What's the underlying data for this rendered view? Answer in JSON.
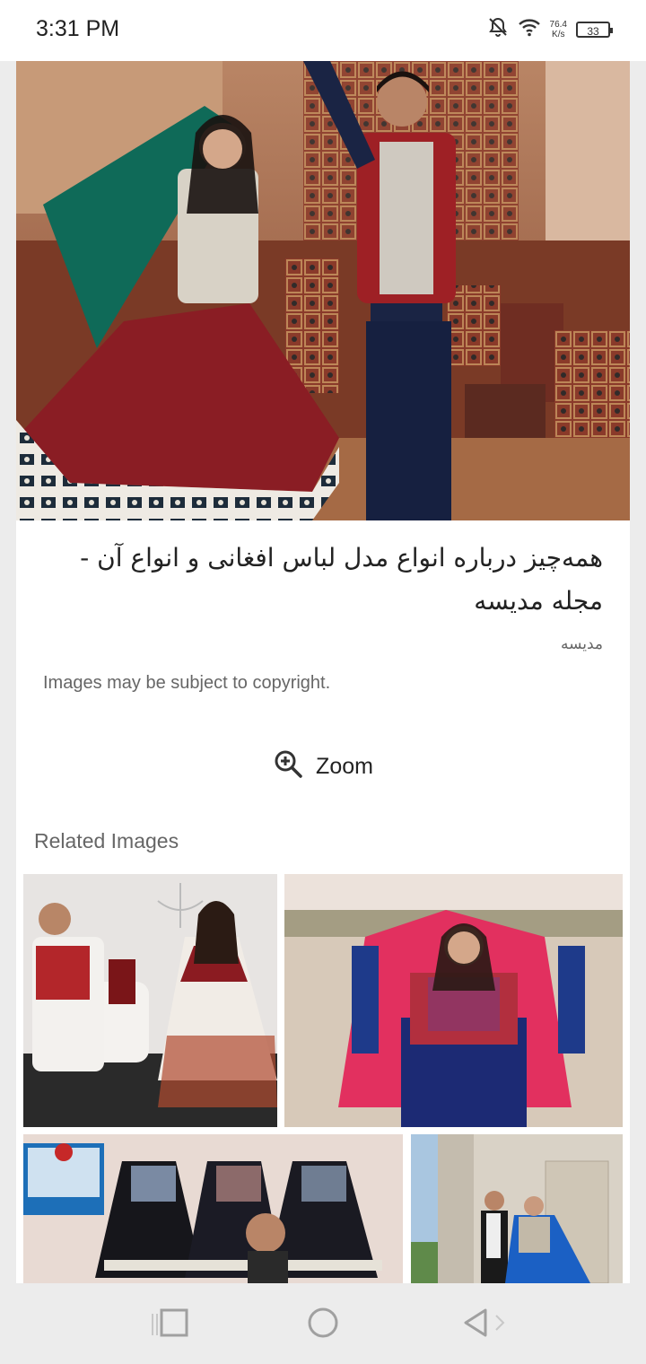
{
  "status_bar": {
    "time": "3:31 PM",
    "net_speed_value": "76.4",
    "net_speed_unit": "K/s",
    "battery": "33",
    "icons": [
      "notifications-off-icon",
      "wifi-icon",
      "battery-icon"
    ]
  },
  "image_detail": {
    "caption": "همه‌چیز درباره انواع مدل لباس افغانی و انواع آن - مجله مدیسه",
    "source": "مدیسه",
    "copyright_notice": "Images may be subject to copyright.",
    "zoom_label": "Zoom"
  },
  "related": {
    "title": "Related Images"
  },
  "nav_bar": {
    "icons": [
      "recents-icon",
      "home-icon",
      "back-icon"
    ]
  }
}
